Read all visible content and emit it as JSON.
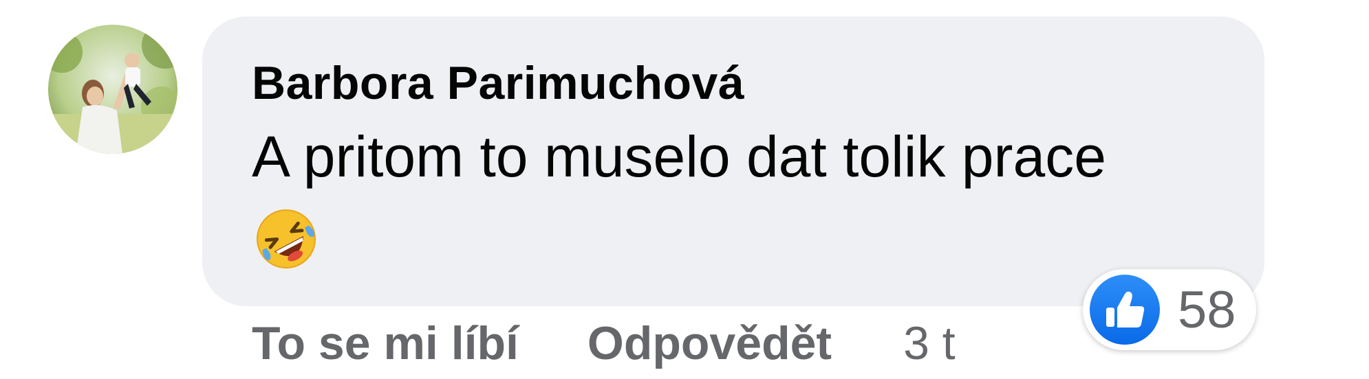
{
  "comment": {
    "author": "Barbora Parimuchová",
    "text": "A pritom to muselo dat tolik prace",
    "emoji": "rolling-on-floor-laughing-emoji",
    "avatar": "profile-photo-avatar"
  },
  "reactions": {
    "type": "like-reaction-icon",
    "count": "58",
    "color": "#1877f2"
  },
  "actions": {
    "like_label": "To se mi líbí",
    "reply_label": "Odpovědět",
    "time": "3 t"
  },
  "colors": {
    "bubble": "#eff0f3",
    "text": "#050505",
    "secondary": "#65676b"
  }
}
